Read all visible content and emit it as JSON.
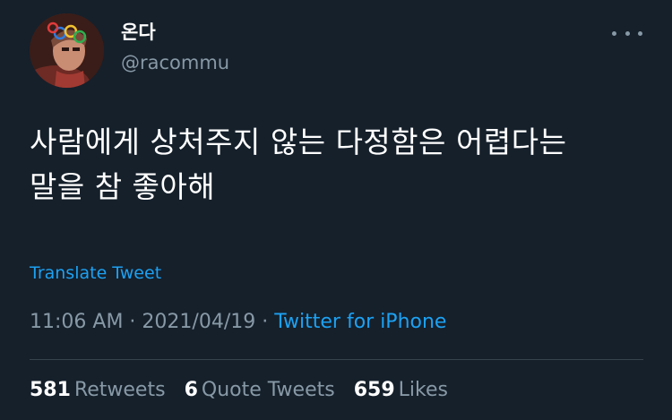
{
  "user": {
    "display_name": "온다",
    "handle": "@racommu"
  },
  "tweet": {
    "text_line1": "사람에게 상처주지 않는 다정함은 어렵다는",
    "text_line2": "말을 참 좋아해",
    "translate_label": "Translate Tweet"
  },
  "meta": {
    "time": "11:06 AM",
    "separator1": " · ",
    "date": "2021/04/19",
    "separator2": " · ",
    "source": "Twitter for iPhone"
  },
  "stats": {
    "retweets_count": "581",
    "retweets_label": "Retweets",
    "quotes_count": "6",
    "quotes_label": "Quote Tweets",
    "likes_count": "659",
    "likes_label": "Likes"
  },
  "icons": {
    "more": "more-horizontal-icon",
    "avatar": "avatar"
  },
  "colors": {
    "background": "#15202b",
    "text_primary": "#ffffff",
    "text_secondary": "#8899a6",
    "accent": "#1da1f2",
    "divider": "#38444d"
  }
}
